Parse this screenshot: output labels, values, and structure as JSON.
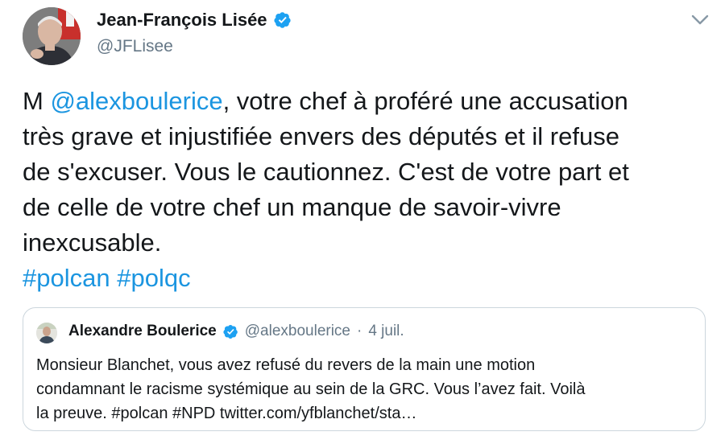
{
  "author": {
    "name": "Jean-François Lisée",
    "handle": "@JFLisee",
    "verified": true,
    "verified_color": "#1da1f2"
  },
  "tweet": {
    "line1_pre": "M ",
    "mention": "@alexboulerice",
    "line1_post": ", votre chef à proféré une accusation",
    "line2": "très grave et injustifiée envers des députés et il refuse",
    "line3": "de s'excuser. Vous le cautionnez. C'est de votre part et",
    "line4": "de celle de votre chef un manque de savoir-vivre",
    "line5": "inexcusable.",
    "hashtag1": "#polcan",
    "hashtag2": "#polqc",
    "link_color": "#1b95e0"
  },
  "quoted_tweet": {
    "name": "Alexandre Boulerice",
    "handle": "@alexboulerice",
    "separator": "·",
    "date": "4 juil.",
    "line1": "Monsieur Blanchet, vous avez refusé du revers de la main une motion",
    "line2": "condamnant le racisme systémique au sein de la GRC. Vous l’avez fait. Voilà",
    "line3": "la preuve. #polcan #NPD twitter.com/yfblanchet/sta…"
  },
  "icons": {
    "verified": "verified-badge-icon",
    "more": "chevron-down-icon"
  }
}
